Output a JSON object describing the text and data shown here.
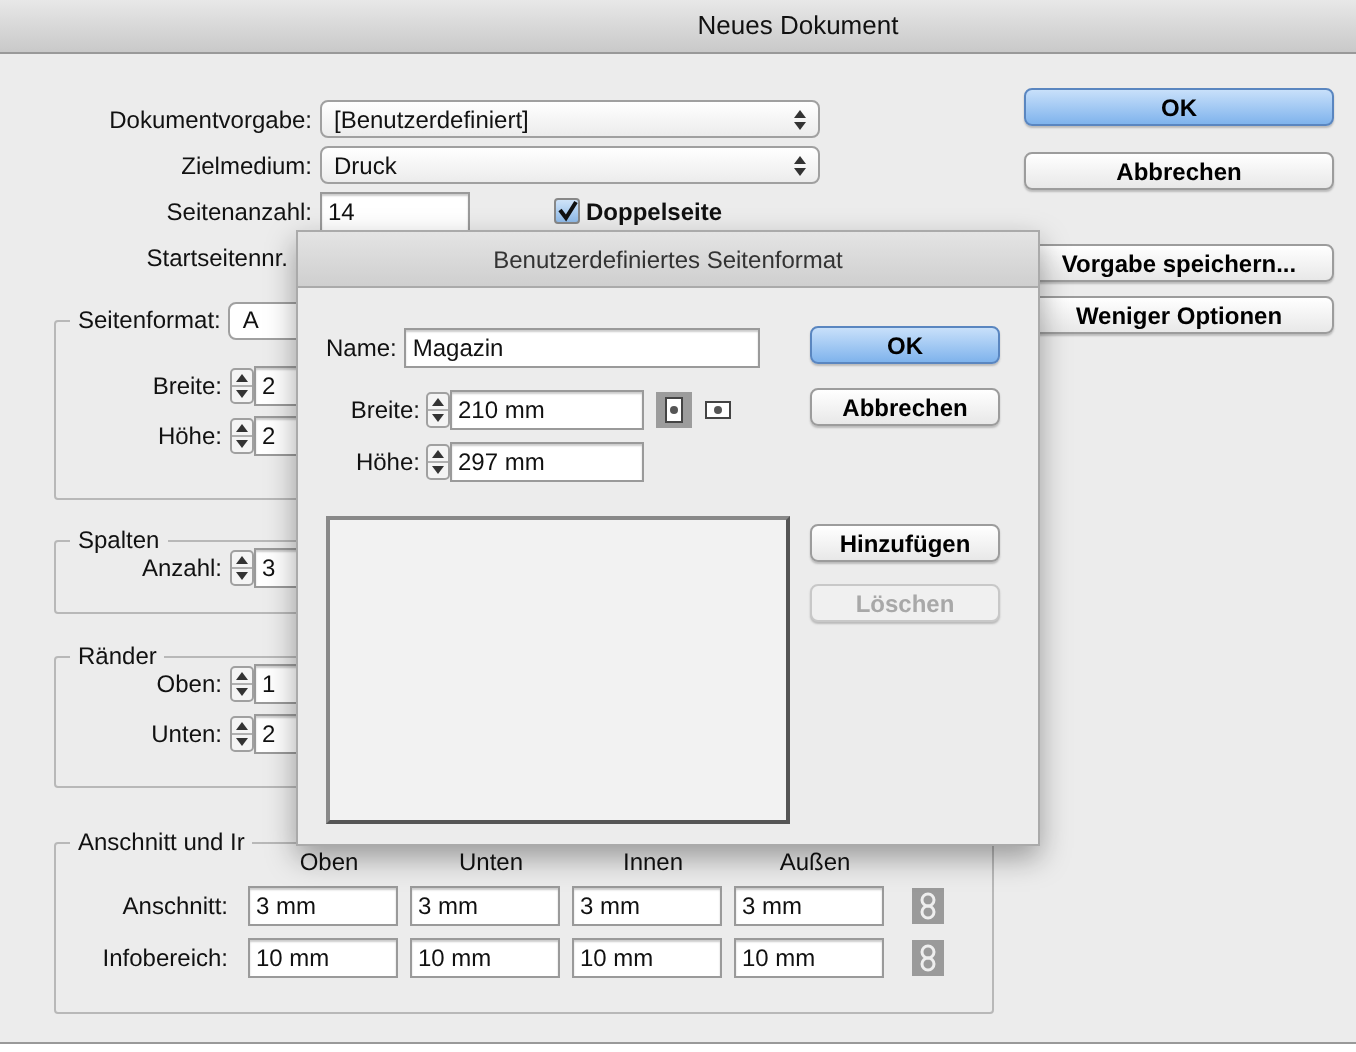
{
  "window": {
    "title": "Neues Dokument"
  },
  "fields": [
    {
      "kind": "select",
      "label": "Dokumentvorgabe:",
      "value": "[Benutzerdefiniert]"
    },
    {
      "kind": "select",
      "label": "Zielmedium:",
      "value": "Druck"
    },
    {
      "kind": "text",
      "label": "Seitenanzahl:",
      "value": "14"
    },
    {
      "kind": "label",
      "label": "Startseitennr."
    }
  ],
  "facing_pages": {
    "label": "Doppelseite",
    "checked": true
  },
  "buttons": [
    {
      "label": "OK",
      "default": true
    },
    {
      "label": "Abbrechen",
      "default": false
    },
    {
      "label": "Vorgabe speichern...",
      "default": false
    },
    {
      "label": "Weniger Optionen",
      "default": false
    }
  ],
  "page_size": {
    "label": "Seitenformat:",
    "value": "A",
    "rows": [
      {
        "label": "Breite:",
        "value": "2"
      },
      {
        "label": "Höhe:",
        "value": "2"
      }
    ]
  },
  "columns": {
    "title": "Spalten",
    "rows": [
      {
        "label": "Anzahl:",
        "value": "3"
      }
    ]
  },
  "margins": {
    "title": "Ränder",
    "rows": [
      {
        "label": "Oben:",
        "value": "1"
      },
      {
        "label": "Unten:",
        "value": "2"
      }
    ]
  },
  "bleed": {
    "title": "Anschnitt und Ir",
    "headers": [
      "Oben",
      "Unten",
      "Innen",
      "Außen"
    ],
    "rows": [
      {
        "label": "Anschnitt:",
        "values": [
          "3 mm",
          "3 mm",
          "3 mm",
          "3 mm"
        ]
      },
      {
        "label": "Infobereich:",
        "values": [
          "10 mm",
          "10 mm",
          "10 mm",
          "10 mm"
        ]
      }
    ]
  },
  "custom_dialog": {
    "title": "Benutzerdefiniertes Seitenformat",
    "name": {
      "label": "Name:",
      "value": "Magazin"
    },
    "rows": [
      {
        "label": "Breite:",
        "value": "210 mm"
      },
      {
        "label": "Höhe:",
        "value": "297 mm"
      }
    ],
    "orientation": [
      {
        "kind": "portrait",
        "selected": true
      },
      {
        "kind": "landscape",
        "selected": false
      }
    ],
    "buttons": [
      {
        "label": "OK",
        "default": true,
        "disabled": false
      },
      {
        "label": "Abbrechen",
        "default": false,
        "disabled": false
      }
    ],
    "list_buttons": [
      {
        "label": "Hinzufügen",
        "disabled": false
      },
      {
        "label": "Löschen",
        "disabled": true
      }
    ]
  }
}
